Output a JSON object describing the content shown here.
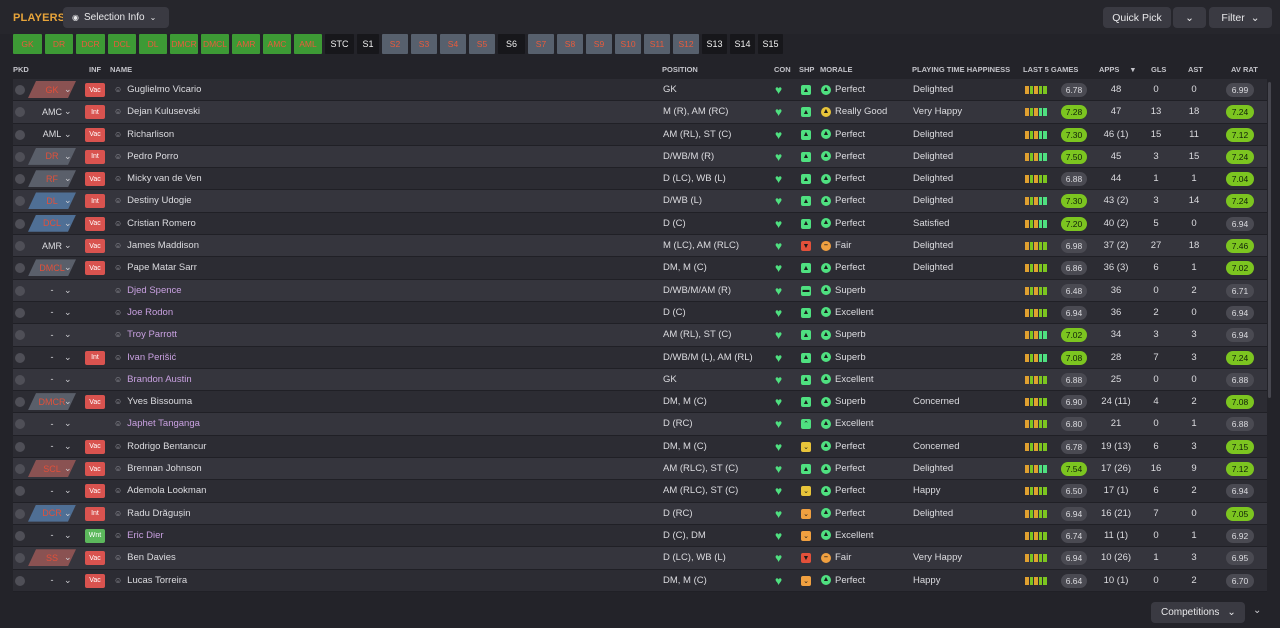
{
  "header": {
    "title": "PLAYERS",
    "selection_info": "Selection Info",
    "quick_pick": "Quick Pick",
    "filter": "Filter"
  },
  "positions": [
    {
      "label": "GK",
      "style": "g"
    },
    {
      "label": "DR",
      "style": "g"
    },
    {
      "label": "DCR",
      "style": "g"
    },
    {
      "label": "DCL",
      "style": "g"
    },
    {
      "label": "DL",
      "style": "g"
    },
    {
      "label": "DMCR",
      "style": "g"
    },
    {
      "label": "DMCL",
      "style": "g"
    },
    {
      "label": "AMR",
      "style": "g"
    },
    {
      "label": "AMC",
      "style": "g"
    },
    {
      "label": "AML",
      "style": "g"
    },
    {
      "label": "STC",
      "style": "k"
    },
    {
      "label": "S1",
      "style": "k"
    },
    {
      "label": "S2",
      "style": "b"
    },
    {
      "label": "S3",
      "style": "b"
    },
    {
      "label": "S4",
      "style": "b"
    },
    {
      "label": "S5",
      "style": "b"
    },
    {
      "label": "S6",
      "style": "k"
    },
    {
      "label": "S7",
      "style": "b"
    },
    {
      "label": "S8",
      "style": "b"
    },
    {
      "label": "S9",
      "style": "b"
    },
    {
      "label": "S10",
      "style": "b"
    },
    {
      "label": "S11",
      "style": "b"
    },
    {
      "label": "S12",
      "style": "b"
    },
    {
      "label": "S13",
      "style": "k"
    },
    {
      "label": "S14",
      "style": "k"
    },
    {
      "label": "S15",
      "style": "k"
    }
  ],
  "columns": {
    "pkd": "PKD",
    "inf": "INF",
    "name": "NAME",
    "position": "POSITION",
    "con": "CON",
    "shp": "SHP",
    "morale": "MORALE",
    "playing_time": "PLAYING TIME HAPPINESS",
    "last5": "LAST 5 GAMES",
    "apps": "APPS",
    "gls": "GLS",
    "ast": "AST",
    "avrat": "AV RAT"
  },
  "colors": {
    "accent": "#e7a43a",
    "green_good": "#3d9a35",
    "rating_high": "#7cc520",
    "rating_mid": "#4a4a52",
    "vac": "#d9534f",
    "wnt": "#5cb85c",
    "pkd_red": "#8a5252",
    "pkd_blue": "#4f6f95",
    "pkd_grey": "#5a5f6a"
  },
  "players": [
    {
      "pkd": "GK",
      "pkd_style": "red",
      "inf": "Vac",
      "name": "Guglielmo Vicario",
      "position": "GK",
      "shp": "up",
      "morale": "Perfect",
      "mor": "p",
      "pt": "Delighted",
      "l5": "6.78",
      "l5hi": false,
      "apps": "48",
      "gls": "0",
      "ast": "0",
      "rat": "6.99",
      "rathi": false,
      "sub": false
    },
    {
      "pkd": "AMC",
      "pkd_style": "none",
      "inf": "Int",
      "name": "Dejan Kulusevski",
      "position": "M (R), AM (RC)",
      "shp": "up",
      "morale": "Really Good",
      "mor": "g",
      "pt": "Very Happy",
      "l5": "7.28",
      "l5hi": true,
      "apps": "47",
      "gls": "13",
      "ast": "18",
      "rat": "7.24",
      "rathi": true,
      "sub": false
    },
    {
      "pkd": "AML",
      "pkd_style": "none",
      "inf": "Vac",
      "name": "Richarlison",
      "position": "AM (RL), ST (C)",
      "shp": "up",
      "morale": "Perfect",
      "mor": "p",
      "pt": "Delighted",
      "l5": "7.30",
      "l5hi": true,
      "apps": "46 (1)",
      "gls": "15",
      "ast": "11",
      "rat": "7.12",
      "rathi": true,
      "sub": false
    },
    {
      "pkd": "DR",
      "pkd_style": "grey",
      "inf": "Int",
      "name": "Pedro Porro",
      "position": "D/WB/M (R)",
      "shp": "up",
      "morale": "Perfect",
      "mor": "p",
      "pt": "Delighted",
      "l5": "7.50",
      "l5hi": true,
      "apps": "45",
      "gls": "3",
      "ast": "15",
      "rat": "7.24",
      "rathi": true,
      "sub": false
    },
    {
      "pkd": "RF",
      "pkd_style": "grey",
      "inf": "Vac",
      "name": "Micky van de Ven",
      "position": "D (LC), WB (L)",
      "shp": "up",
      "morale": "Perfect",
      "mor": "p",
      "pt": "Delighted",
      "l5": "6.88",
      "l5hi": false,
      "apps": "44",
      "gls": "1",
      "ast": "1",
      "rat": "7.04",
      "rathi": true,
      "sub": false
    },
    {
      "pkd": "DL",
      "pkd_style": "blue",
      "inf": "Int",
      "name": "Destiny Udogie",
      "position": "D/WB (L)",
      "shp": "up",
      "morale": "Perfect",
      "mor": "p",
      "pt": "Delighted",
      "l5": "7.30",
      "l5hi": true,
      "apps": "43 (2)",
      "gls": "3",
      "ast": "14",
      "rat": "7.24",
      "rathi": true,
      "sub": false
    },
    {
      "pkd": "DCL",
      "pkd_style": "blue",
      "inf": "Vac",
      "name": "Cristian Romero",
      "position": "D (C)",
      "shp": "up",
      "morale": "Perfect",
      "mor": "p",
      "pt": "Satisfied",
      "l5": "7.20",
      "l5hi": true,
      "apps": "40 (2)",
      "gls": "5",
      "ast": "0",
      "rat": "6.94",
      "rathi": false,
      "sub": false
    },
    {
      "pkd": "AMR",
      "pkd_style": "none",
      "inf": "Vac",
      "name": "James Maddison",
      "position": "M (LC), AM (RLC)",
      "shp": "down",
      "morale": "Fair",
      "mor": "f",
      "pt": "Delighted",
      "l5": "6.98",
      "l5hi": false,
      "apps": "37 (2)",
      "gls": "27",
      "ast": "18",
      "rat": "7.46",
      "rathi": true,
      "sub": false
    },
    {
      "pkd": "DMCL",
      "pkd_style": "grey",
      "inf": "Vac",
      "name": "Pape Matar Sarr",
      "position": "DM, M (C)",
      "shp": "up",
      "morale": "Perfect",
      "mor": "p",
      "pt": "Delighted",
      "l5": "6.86",
      "l5hi": false,
      "apps": "36 (3)",
      "gls": "6",
      "ast": "1",
      "rat": "7.02",
      "rathi": true,
      "sub": false
    },
    {
      "pkd": "-",
      "pkd_style": "none",
      "inf": "",
      "name": "Djed Spence",
      "position": "D/WB/M/AM (R)",
      "shp": "flat",
      "morale": "Superb",
      "mor": "p",
      "pt": "",
      "l5": "6.48",
      "l5hi": false,
      "apps": "36",
      "gls": "0",
      "ast": "2",
      "rat": "6.71",
      "rathi": false,
      "sub": true
    },
    {
      "pkd": "-",
      "pkd_style": "none",
      "inf": "",
      "name": "Joe Rodon",
      "position": "D (C)",
      "shp": "up",
      "morale": "Excellent",
      "mor": "p",
      "pt": "",
      "l5": "6.94",
      "l5hi": false,
      "apps": "36",
      "gls": "2",
      "ast": "0",
      "rat": "6.94",
      "rathi": false,
      "sub": true
    },
    {
      "pkd": "-",
      "pkd_style": "none",
      "inf": "",
      "name": "Troy Parrott",
      "position": "AM (RL), ST (C)",
      "shp": "up",
      "morale": "Superb",
      "mor": "p",
      "pt": "",
      "l5": "7.02",
      "l5hi": true,
      "apps": "34",
      "gls": "3",
      "ast": "3",
      "rat": "6.94",
      "rathi": false,
      "sub": true
    },
    {
      "pkd": "-",
      "pkd_style": "none",
      "inf": "Int",
      "name": "Ivan Perišić",
      "position": "D/WB/M (L), AM (RL)",
      "shp": "up",
      "morale": "Superb",
      "mor": "p",
      "pt": "",
      "l5": "7.08",
      "l5hi": true,
      "apps": "28",
      "gls": "7",
      "ast": "3",
      "rat": "7.24",
      "rathi": true,
      "sub": true
    },
    {
      "pkd": "-",
      "pkd_style": "none",
      "inf": "",
      "name": "Brandon Austin",
      "position": "GK",
      "shp": "up",
      "morale": "Excellent",
      "mor": "p",
      "pt": "",
      "l5": "6.88",
      "l5hi": false,
      "apps": "25",
      "gls": "0",
      "ast": "0",
      "rat": "6.88",
      "rathi": false,
      "sub": true
    },
    {
      "pkd": "DMCR",
      "pkd_style": "grey",
      "inf": "Vac",
      "name": "Yves Bissouma",
      "position": "DM, M (C)",
      "shp": "up",
      "morale": "Superb",
      "mor": "p",
      "pt": "Concerned",
      "l5": "6.90",
      "l5hi": false,
      "apps": "24 (11)",
      "gls": "4",
      "ast": "2",
      "rat": "7.08",
      "rathi": true,
      "sub": false
    },
    {
      "pkd": "-",
      "pkd_style": "none",
      "inf": "",
      "name": "Japhet Tanganga",
      "position": "D (RC)",
      "shp": "uparrow",
      "morale": "Excellent",
      "mor": "p",
      "pt": "",
      "l5": "6.80",
      "l5hi": false,
      "apps": "21",
      "gls": "0",
      "ast": "1",
      "rat": "6.88",
      "rathi": false,
      "sub": true
    },
    {
      "pkd": "-",
      "pkd_style": "none",
      "inf": "Vac",
      "name": "Rodrigo Bentancur",
      "position": "DM, M (C)",
      "shp": "yel",
      "morale": "Perfect",
      "mor": "p",
      "pt": "Concerned",
      "l5": "6.78",
      "l5hi": false,
      "apps": "19 (13)",
      "gls": "6",
      "ast": "3",
      "rat": "7.15",
      "rathi": true,
      "sub": false
    },
    {
      "pkd": "SCL",
      "pkd_style": "red",
      "inf": "Vac",
      "name": "Brennan Johnson",
      "position": "AM (RLC), ST (C)",
      "shp": "up",
      "morale": "Perfect",
      "mor": "p",
      "pt": "Delighted",
      "l5": "7.54",
      "l5hi": true,
      "apps": "17 (26)",
      "gls": "16",
      "ast": "9",
      "rat": "7.12",
      "rathi": true,
      "sub": false
    },
    {
      "pkd": "-",
      "pkd_style": "none",
      "inf": "Vac",
      "name": "Ademola Lookman",
      "position": "AM (RLC), ST (C)",
      "shp": "yel",
      "morale": "Perfect",
      "mor": "p",
      "pt": "Happy",
      "l5": "6.50",
      "l5hi": false,
      "apps": "17 (1)",
      "gls": "6",
      "ast": "2",
      "rat": "6.94",
      "rathi": false,
      "sub": false
    },
    {
      "pkd": "DCR",
      "pkd_style": "blue",
      "inf": "Int",
      "name": "Radu Drăgușin",
      "position": "D (RC)",
      "shp": "org",
      "morale": "Perfect",
      "mor": "p",
      "pt": "Delighted",
      "l5": "6.94",
      "l5hi": false,
      "apps": "16 (21)",
      "gls": "7",
      "ast": "0",
      "rat": "7.05",
      "rathi": true,
      "sub": false
    },
    {
      "pkd": "-",
      "pkd_style": "none",
      "inf": "Wnt",
      "name": "Eric Dier",
      "position": "D (C), DM",
      "shp": "org",
      "morale": "Excellent",
      "mor": "p",
      "pt": "",
      "l5": "6.74",
      "l5hi": false,
      "apps": "11 (1)",
      "gls": "0",
      "ast": "1",
      "rat": "6.92",
      "rathi": false,
      "sub": true
    },
    {
      "pkd": "SS",
      "pkd_style": "red",
      "inf": "Vac",
      "name": "Ben Davies",
      "position": "D (LC), WB (L)",
      "shp": "down",
      "morale": "Fair",
      "mor": "f",
      "pt": "Very Happy",
      "l5": "6.94",
      "l5hi": false,
      "apps": "10 (26)",
      "gls": "1",
      "ast": "3",
      "rat": "6.95",
      "rathi": false,
      "sub": false
    },
    {
      "pkd": "-",
      "pkd_style": "none",
      "inf": "Vac",
      "name": "Lucas Torreira",
      "position": "DM, M (C)",
      "shp": "org",
      "morale": "Perfect",
      "mor": "p",
      "pt": "Happy",
      "l5": "6.64",
      "l5hi": false,
      "apps": "10 (1)",
      "gls": "0",
      "ast": "2",
      "rat": "6.70",
      "rathi": false,
      "sub": false
    }
  ],
  "footer": {
    "competitions": "Competitions"
  }
}
